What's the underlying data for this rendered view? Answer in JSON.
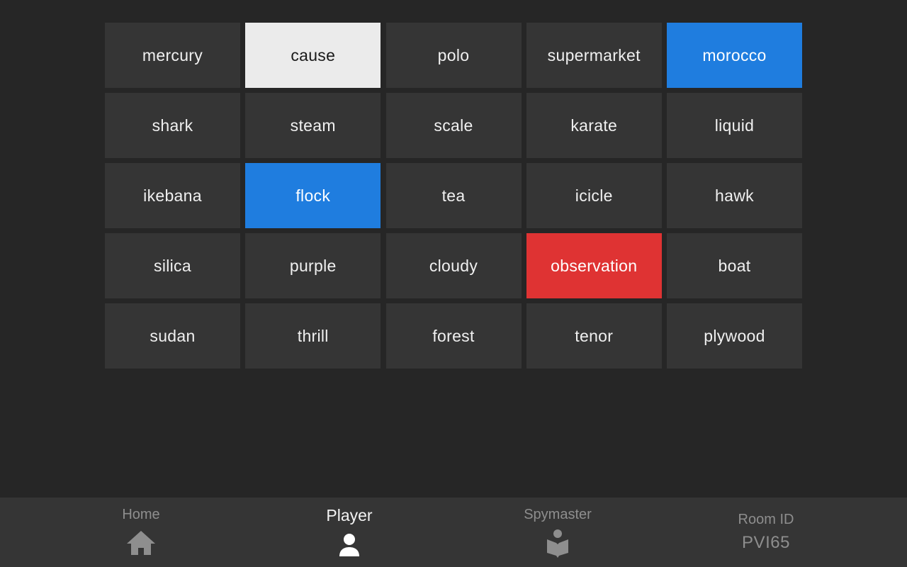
{
  "board": {
    "cards": [
      {
        "word": "mercury",
        "state": "hidden"
      },
      {
        "word": "cause",
        "state": "neutral-revealed"
      },
      {
        "word": "polo",
        "state": "hidden"
      },
      {
        "word": "supermarket",
        "state": "hidden"
      },
      {
        "word": "morocco",
        "state": "blue"
      },
      {
        "word": "shark",
        "state": "hidden"
      },
      {
        "word": "steam",
        "state": "hidden"
      },
      {
        "word": "scale",
        "state": "hidden"
      },
      {
        "word": "karate",
        "state": "hidden"
      },
      {
        "word": "liquid",
        "state": "hidden"
      },
      {
        "word": "ikebana",
        "state": "hidden"
      },
      {
        "word": "flock",
        "state": "blue"
      },
      {
        "word": "tea",
        "state": "hidden"
      },
      {
        "word": "icicle",
        "state": "hidden"
      },
      {
        "word": "hawk",
        "state": "hidden"
      },
      {
        "word": "silica",
        "state": "hidden"
      },
      {
        "word": "purple",
        "state": "hidden"
      },
      {
        "word": "cloudy",
        "state": "hidden"
      },
      {
        "word": "observation",
        "state": "red"
      },
      {
        "word": "boat",
        "state": "hidden"
      },
      {
        "word": "sudan",
        "state": "hidden"
      },
      {
        "word": "thrill",
        "state": "hidden"
      },
      {
        "word": "forest",
        "state": "hidden"
      },
      {
        "word": "tenor",
        "state": "hidden"
      },
      {
        "word": "plywood",
        "state": "hidden"
      }
    ]
  },
  "colors": {
    "background": "#262626",
    "card_hidden": "#353535",
    "card_neutral_revealed": "#ebebeb",
    "team_blue": "#1f7ddf",
    "team_red": "#df3333"
  },
  "footer": {
    "nav": [
      {
        "label": "Home",
        "icon": "home-icon",
        "active": false
      },
      {
        "label": "Player",
        "icon": "person-icon",
        "active": true
      },
      {
        "label": "Spymaster",
        "icon": "reader-icon",
        "active": false
      }
    ],
    "room": {
      "label": "Room ID",
      "id": "PVI65"
    }
  }
}
